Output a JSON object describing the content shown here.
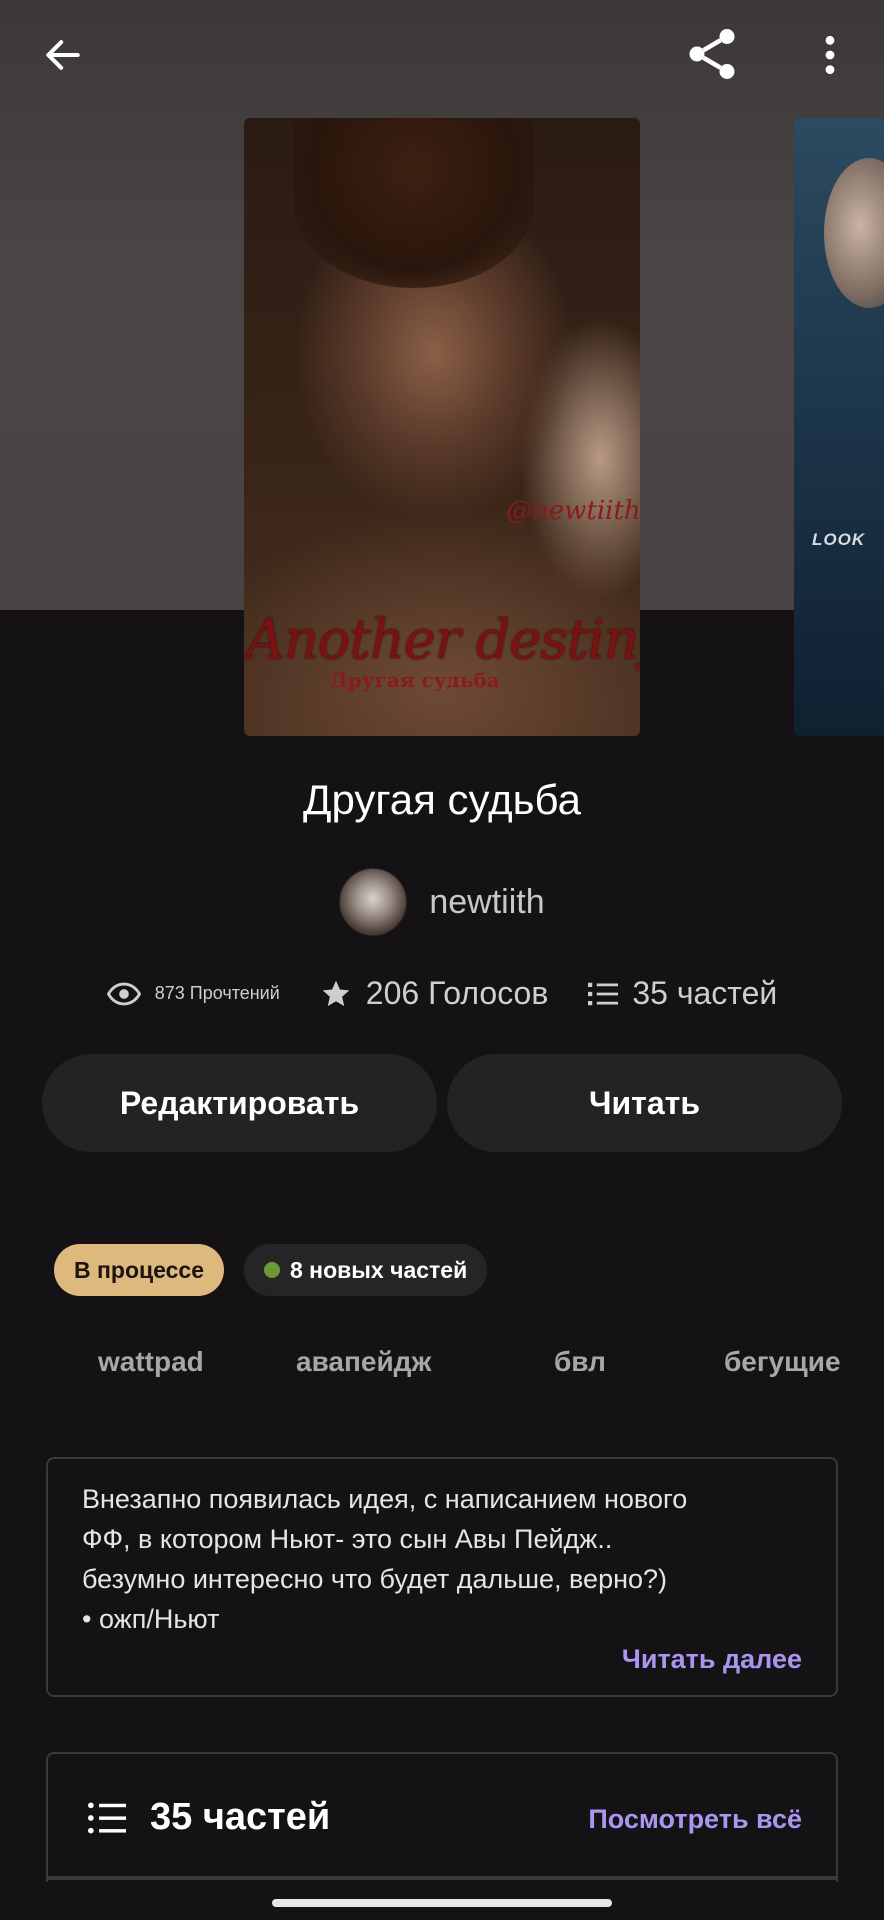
{
  "header": {
    "back_icon": "arrow-left-icon",
    "share_icon": "share-icon",
    "more_icon": "more-vertical-icon"
  },
  "cover": {
    "watermark": "@newtiith",
    "title": "Another destiny",
    "subtitle": "Другая судьба",
    "next_cover_text": "LOOK"
  },
  "story": {
    "title": "Другая судьба",
    "author": "newtiith"
  },
  "stats": {
    "reads": "873 Прочтений",
    "votes": "206 Голосов",
    "parts": "35 частей"
  },
  "actions": {
    "edit_label": "Редактировать",
    "read_label": "Читать"
  },
  "badges": {
    "status": "В процессе",
    "new_parts": "8 новых частей",
    "status_color": "#ddb97e",
    "new_dot_color": "#6c9a3a"
  },
  "tags": [
    "wattpad",
    "авапейдж",
    "бвл",
    "бегущие"
  ],
  "description": {
    "lines": [
      "Внезапно появилась идея, с написанием нового",
      "ФФ, в котором Ньют- это сын Авы Пейдж..",
      "безумно интересно что будет дальше, верно?)",
      "• ожп/Ньют"
    ],
    "read_more": "Читать далее"
  },
  "parts_section": {
    "title": "35 частей",
    "view_all": "Посмотреть всё",
    "accent_color": "#a896f0"
  }
}
